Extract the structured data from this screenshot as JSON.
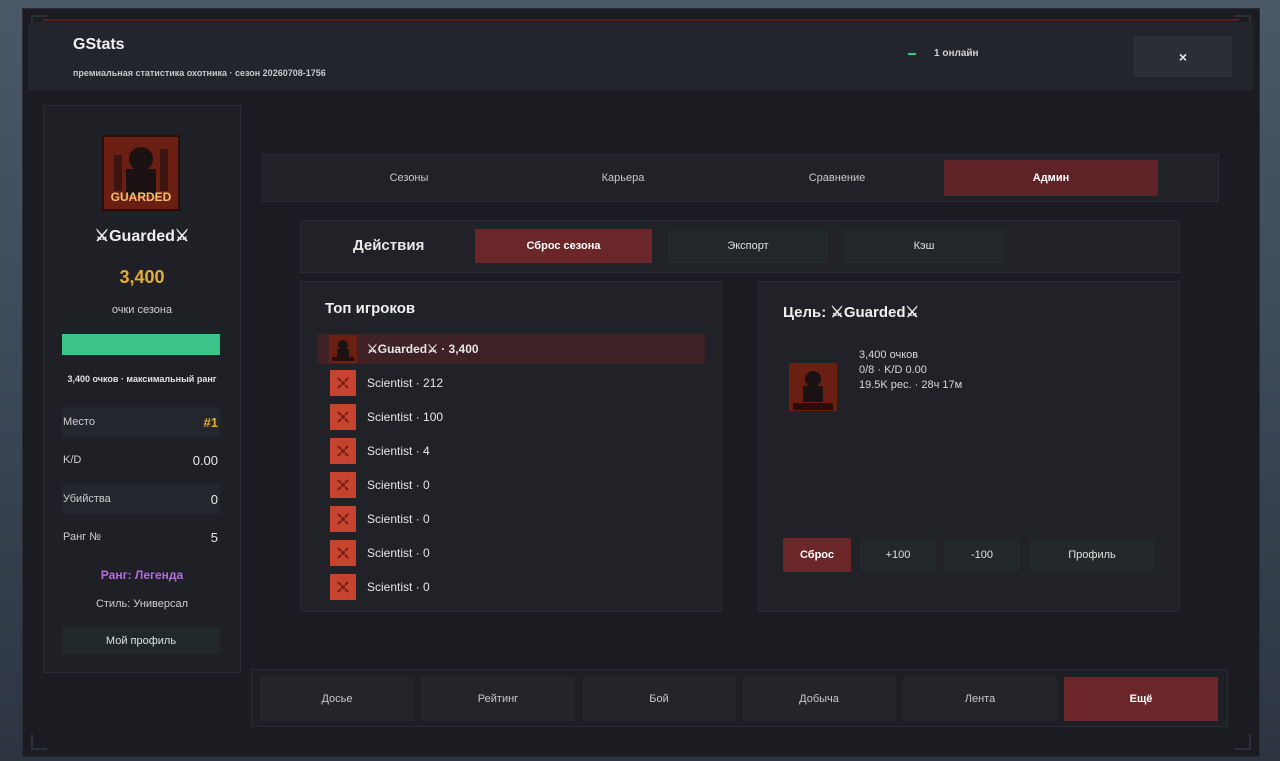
{
  "header": {
    "title": "GStats",
    "subtitle": "премиальная статистика охотника · сезон 20260708-1756",
    "online_text": "1 онлайн",
    "close_label": "×"
  },
  "sidebar": {
    "avatar_text": "GUARDED",
    "name": "⚔Guarded⚔",
    "points": "3,400",
    "points_label": "очки сезона",
    "progress_fraction": 1.0,
    "progress_text": "3,400 очков · максимальный ранг",
    "stats": [
      {
        "label": "Место",
        "value": "#1"
      },
      {
        "label": "K/D",
        "value": "0.00"
      },
      {
        "label": "Убийства",
        "value": "0"
      },
      {
        "label": "Ранг №",
        "value": "5"
      }
    ],
    "rank_text": "Ранг: Легенда",
    "style_text": "Стиль: Универсал",
    "profile_button": "Мой профиль"
  },
  "tabs": [
    {
      "label": "Сезоны"
    },
    {
      "label": "Карьера"
    },
    {
      "label": "Сравнение"
    },
    {
      "label": "Админ"
    }
  ],
  "actions": {
    "title": "Действия",
    "buttons": [
      {
        "label": "Сброс сезона"
      },
      {
        "label": "Экспорт"
      },
      {
        "label": "Кэш"
      }
    ]
  },
  "top_players": {
    "title": "Топ игроков",
    "players": [
      {
        "text": "⚔Guarded⚔ · 3,400"
      },
      {
        "text": "Scientist · 212"
      },
      {
        "text": "Scientist · 100"
      },
      {
        "text": "Scientist · 4"
      },
      {
        "text": "Scientist · 0"
      },
      {
        "text": "Scientist · 0"
      },
      {
        "text": "Scientist · 0"
      },
      {
        "text": "Scientist · 0"
      }
    ]
  },
  "target": {
    "title": "Цель: ⚔Guarded⚔",
    "line1": "3,400 очков",
    "line2": "0/8 · K/D 0.00",
    "line3": "19.5K рес. · 28ч 17м",
    "buttons": [
      {
        "label": "Сброс"
      },
      {
        "label": "+100"
      },
      {
        "label": "-100"
      },
      {
        "label": "Профиль"
      }
    ]
  },
  "bottom_nav": [
    {
      "label": "Досье"
    },
    {
      "label": "Рейтинг"
    },
    {
      "label": "Бой"
    },
    {
      "label": "Добыча"
    },
    {
      "label": "Лента"
    },
    {
      "label": "Ещё"
    }
  ],
  "colors": {
    "accent_red": "#6b2629",
    "progress_green": "#3cc48a",
    "gold": "#e3ad38",
    "rank_purple": "#b46ce0"
  }
}
